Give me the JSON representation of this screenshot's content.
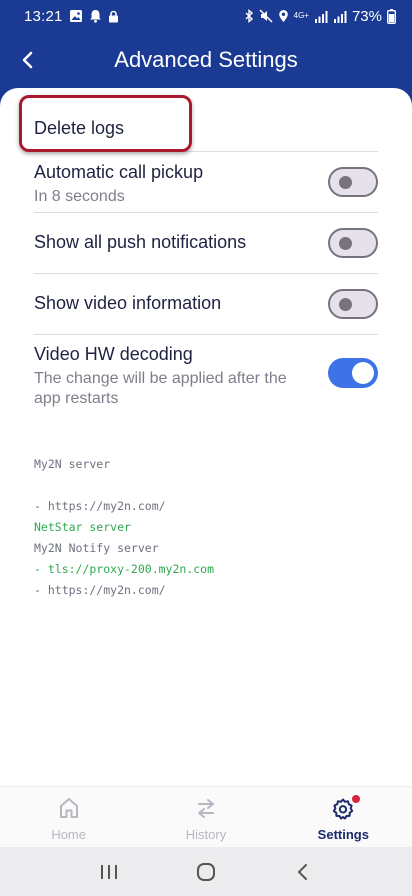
{
  "status": {
    "time": "13:21",
    "network": "4G+",
    "battery": "73%"
  },
  "header": {
    "title": "Advanced Settings"
  },
  "settings": {
    "delete_logs": "Delete logs",
    "auto_pickup": {
      "title": "Automatic call pickup",
      "subtitle": "In 8 seconds",
      "enabled": false
    },
    "push_notifications": {
      "title": "Show all push notifications",
      "enabled": false
    },
    "video_info": {
      "title": "Show video information",
      "enabled": false
    },
    "hw_decoding": {
      "title": "Video HW decoding",
      "subtitle": "The change will be applied after the app restarts",
      "enabled": true
    }
  },
  "servers": {
    "my2n_label": "My2N server",
    "my2n_url": "- https://my2n.com/",
    "notify_label": "My2N Notify server",
    "notify_url": "- https://my2n.com/",
    "netstar_label": "NetStar server",
    "netstar_url": "- tls://proxy-200.my2n.com"
  },
  "nav": {
    "items": [
      {
        "label": "Home",
        "icon": "home-icon",
        "active": false
      },
      {
        "label": "History",
        "icon": "history-icon",
        "active": false
      },
      {
        "label": "Settings",
        "icon": "gear-icon",
        "active": true
      }
    ]
  },
  "colors": {
    "header_bg": "#1b3a93",
    "toggle_on": "#3d73e6",
    "highlight": "#a8192e",
    "netstar_text": "#2fa84f"
  }
}
